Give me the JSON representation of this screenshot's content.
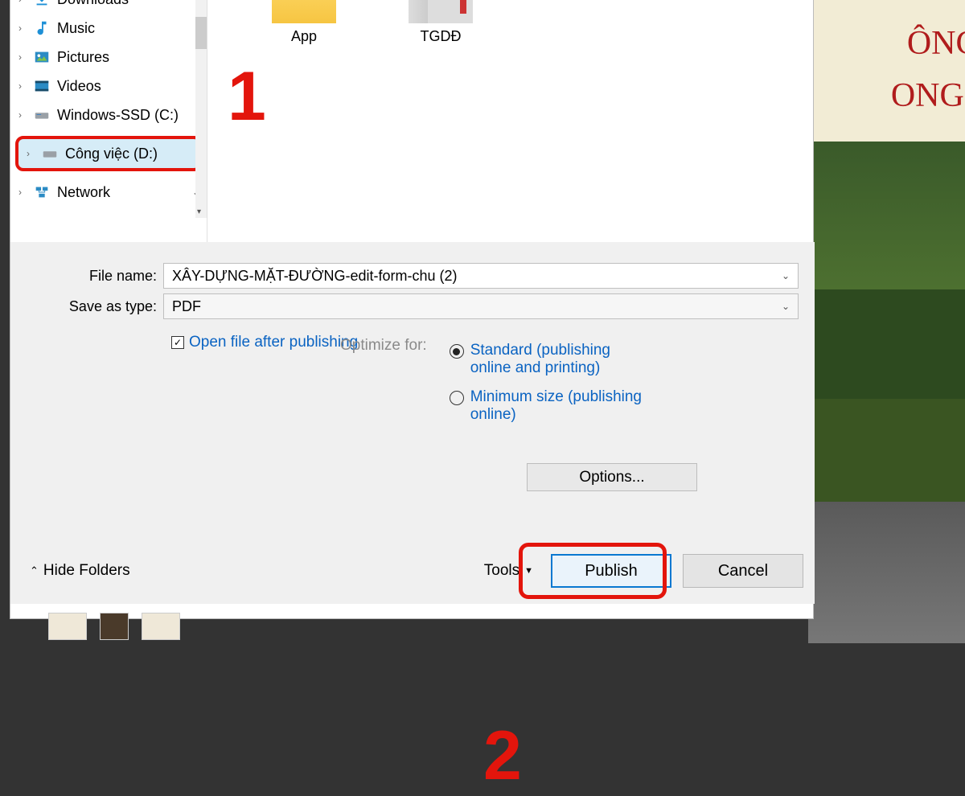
{
  "sidebar": {
    "items": [
      {
        "label": "Downloads",
        "icon": "download-icon"
      },
      {
        "label": "Music",
        "icon": "music-icon"
      },
      {
        "label": "Pictures",
        "icon": "picture-icon"
      },
      {
        "label": "Videos",
        "icon": "video-icon"
      },
      {
        "label": "Windows-SSD (C:)",
        "icon": "drive-icon"
      },
      {
        "label": "Công việc (D:)",
        "icon": "drive-icon"
      },
      {
        "label": "Network",
        "icon": "network-icon"
      }
    ]
  },
  "content": {
    "folders": [
      {
        "label": "App"
      },
      {
        "label": "TGDĐ"
      }
    ]
  },
  "form": {
    "filename_label": "File name:",
    "filename_value": "XÂY-DỰNG-MẶT-ĐƯỜNG-edit-form-chu (2)",
    "savetype_label": "Save as type:",
    "savetype_value": "PDF",
    "open_after_label": "Open file after publishing",
    "optimize_label": "Optimize for:",
    "radio_standard": "Standard (publishing online and printing)",
    "radio_minimum": "Minimum size (publishing online)",
    "options_btn": "Options...",
    "hide_folders": "Hide Folders",
    "tools": "Tools",
    "publish": "Publish",
    "cancel": "Cancel"
  },
  "annotations": {
    "one": "1",
    "two": "2"
  },
  "background": {
    "title1": "ÔNG HẠ",
    "title2": "ONG DỤ"
  }
}
